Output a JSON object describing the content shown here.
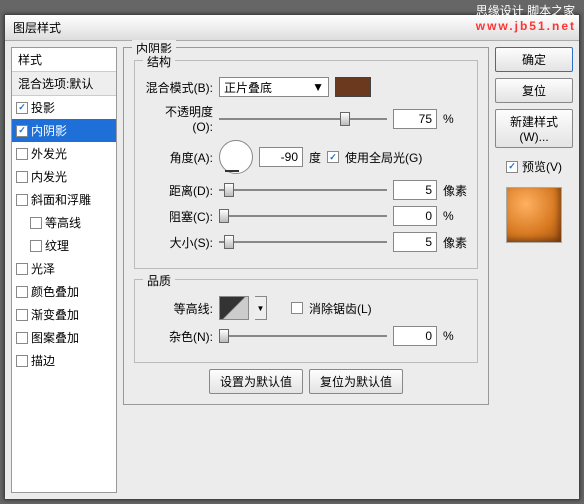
{
  "watermark": {
    "line1": "思缘设计 脚本之家",
    "line2": "www.jb51.net"
  },
  "title": "图层样式",
  "sidebar": {
    "header": "样式",
    "sub": "混合选项:默认",
    "items": [
      {
        "label": "投影",
        "checked": true,
        "selected": false
      },
      {
        "label": "内阴影",
        "checked": true,
        "selected": true
      },
      {
        "label": "外发光",
        "checked": false,
        "selected": false
      },
      {
        "label": "内发光",
        "checked": false,
        "selected": false
      },
      {
        "label": "斜面和浮雕",
        "checked": false,
        "selected": false
      },
      {
        "label": "等高线",
        "checked": false,
        "selected": false,
        "indent": true
      },
      {
        "label": "纹理",
        "checked": false,
        "selected": false,
        "indent": true
      },
      {
        "label": "光泽",
        "checked": false,
        "selected": false
      },
      {
        "label": "颜色叠加",
        "checked": false,
        "selected": false
      },
      {
        "label": "渐变叠加",
        "checked": false,
        "selected": false
      },
      {
        "label": "图案叠加",
        "checked": false,
        "selected": false
      },
      {
        "label": "描边",
        "checked": false,
        "selected": false
      }
    ]
  },
  "panel": {
    "title": "内阴影",
    "structure": {
      "legend": "结构",
      "blend_label": "混合模式(B):",
      "blend_value": "正片叠底",
      "opacity_label": "不透明度(O):",
      "opacity_value": "75",
      "opacity_unit": "%",
      "angle_label": "角度(A):",
      "angle_value": "-90",
      "angle_unit": "度",
      "global_label": "使用全局光(G)",
      "global_checked": true,
      "distance_label": "距离(D):",
      "distance_value": "5",
      "distance_unit": "像素",
      "choke_label": "阻塞(C):",
      "choke_value": "0",
      "choke_unit": "%",
      "size_label": "大小(S):",
      "size_value": "5",
      "size_unit": "像素"
    },
    "quality": {
      "legend": "品质",
      "contour_label": "等高线:",
      "aa_label": "消除锯齿(L)",
      "aa_checked": false,
      "noise_label": "杂色(N):",
      "noise_value": "0",
      "noise_unit": "%"
    },
    "btn_default": "设置为默认值",
    "btn_reset": "复位为默认值"
  },
  "buttons": {
    "ok": "确定",
    "cancel": "复位",
    "new_style": "新建样式(W)...",
    "preview": "预览(V)"
  }
}
